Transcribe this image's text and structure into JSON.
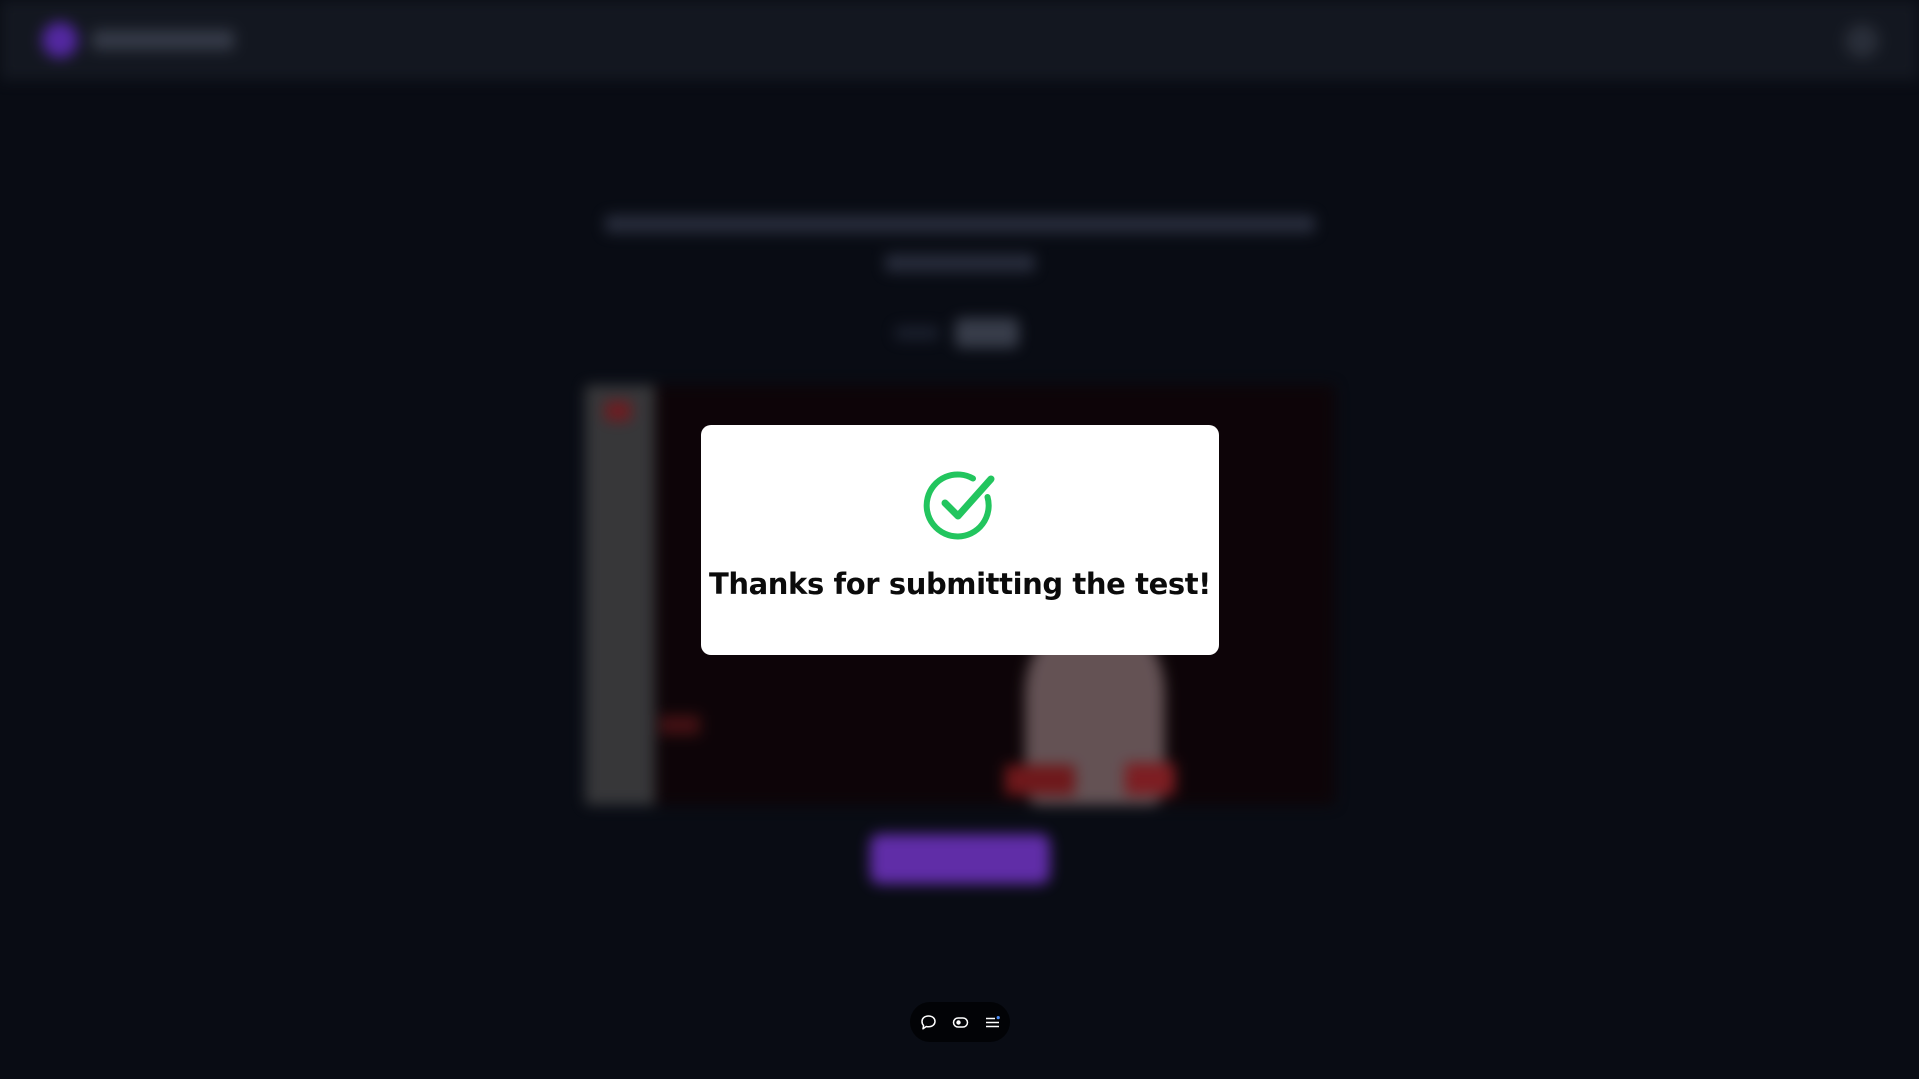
{
  "modal": {
    "title": "Thanks for submitting the test!",
    "icon": "check-circle-icon",
    "icon_color": "#22c55e"
  },
  "toolbar": {
    "items": [
      {
        "icon": "chat-bubble-icon"
      },
      {
        "icon": "camera-toggle-icon"
      },
      {
        "icon": "list-menu-icon"
      }
    ]
  },
  "colors": {
    "background": "#090c14",
    "topbar": "#151922",
    "accent": "#6a31b8",
    "modal_bg": "#ffffff",
    "success": "#22c55e"
  }
}
